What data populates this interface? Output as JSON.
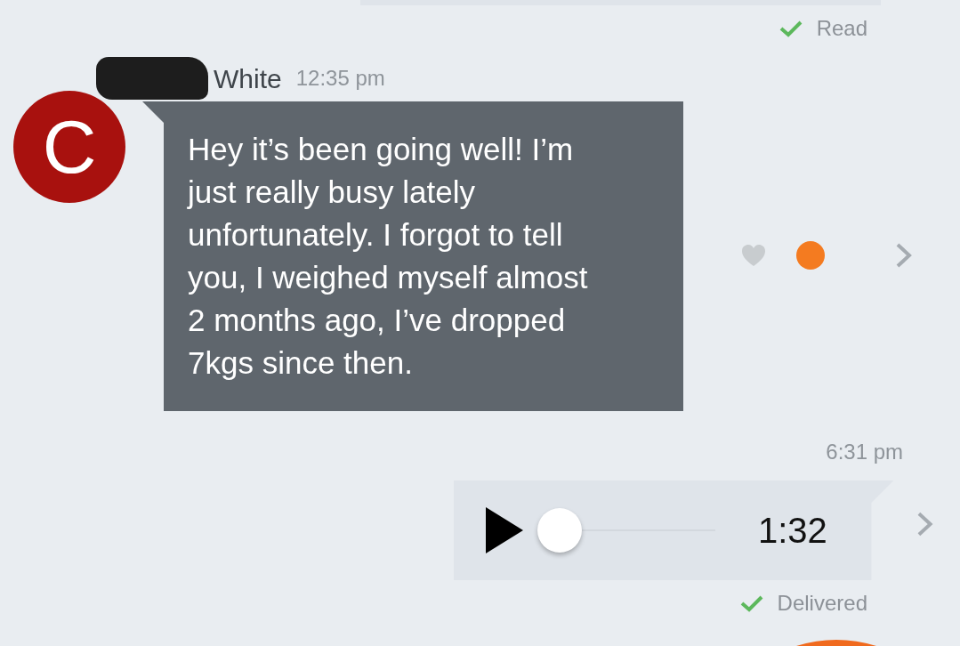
{
  "previous_message": {
    "status": "Read"
  },
  "incoming": {
    "sender": "White",
    "time": "12:35 pm",
    "avatar_letter": "C",
    "text": "Hey it’s been going well! I’m just really busy lately unfortunately. I forgot to tell you, I weighed myself almost 2 months ago, I’ve dropped 7kgs since then.",
    "liked": false
  },
  "outgoing": {
    "time": "6:31 pm",
    "kind": "audio",
    "playing": false,
    "level": 0,
    "duration": "1:32",
    "status": "Delivered"
  }
}
